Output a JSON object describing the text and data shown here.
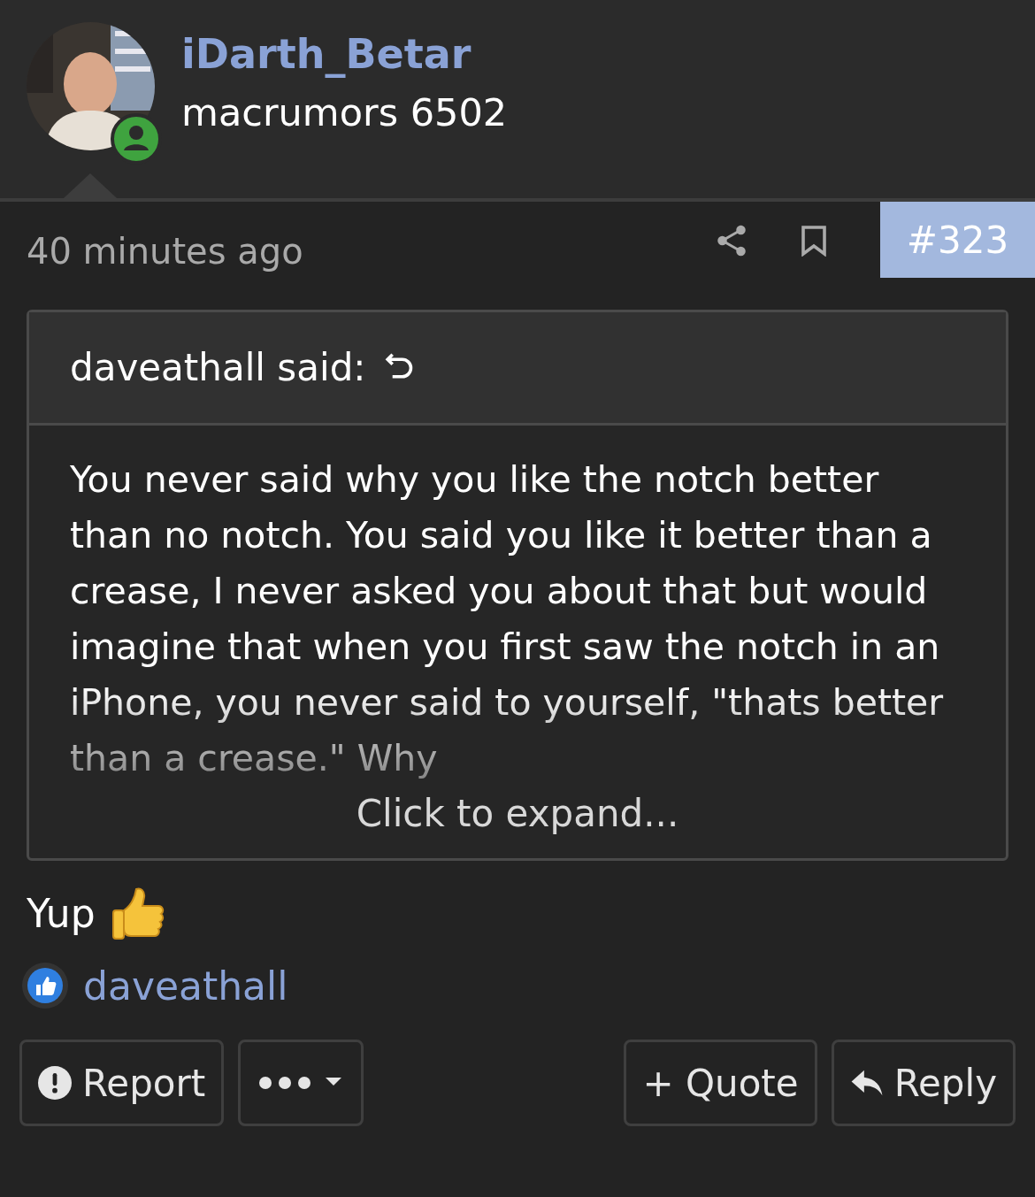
{
  "author": {
    "name": "iDarth_Betar",
    "title": "macrumors 6502",
    "online": true
  },
  "post": {
    "time": "40 minutes ago",
    "number": "#323"
  },
  "quote": {
    "attribution": "daveathall said:",
    "text": "You never said why you like the notch better than no notch. You said you like it better than a crease, I never asked you about that but would imagine that when you first saw the notch in an iPhone, you never said to yourself, \"thats better than a crease.\" Why",
    "expand": "Click to expand..."
  },
  "message": "Yup",
  "reactions": {
    "users": [
      "daveathall"
    ]
  },
  "actions": {
    "left": [
      {
        "kind": "report",
        "label": "Report"
      },
      {
        "kind": "more"
      }
    ],
    "right": [
      {
        "kind": "quote",
        "label": "+ Quote"
      },
      {
        "kind": "reply",
        "label": "Reply"
      }
    ]
  }
}
